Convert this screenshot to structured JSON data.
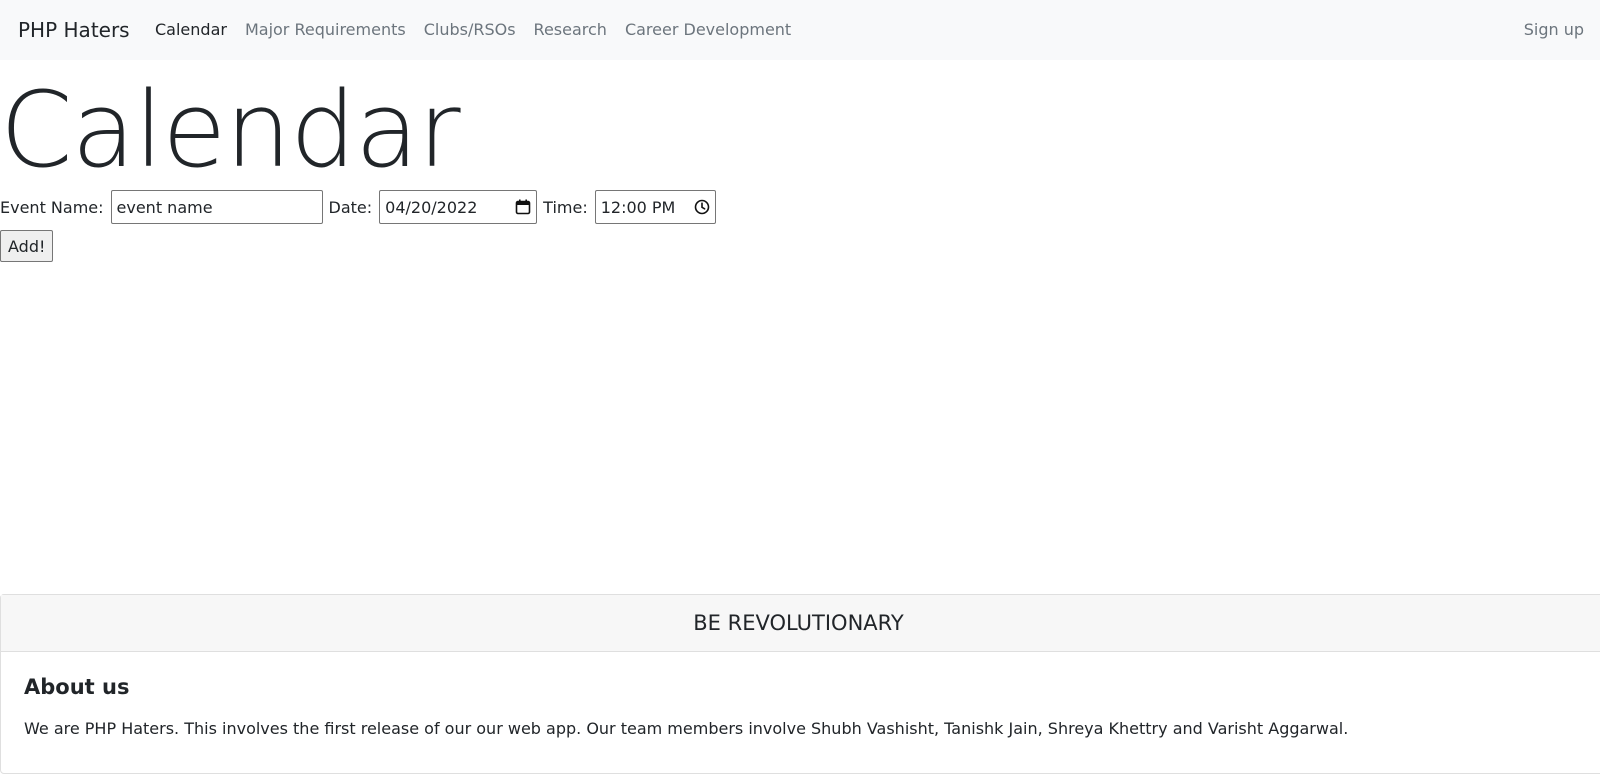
{
  "navbar": {
    "brand": "PHP Haters",
    "links": [
      {
        "label": "Calendar",
        "active": true
      },
      {
        "label": "Major Requirements",
        "active": false
      },
      {
        "label": "Clubs/RSOs",
        "active": false
      },
      {
        "label": "Research",
        "active": false
      },
      {
        "label": "Career Development",
        "active": false
      }
    ],
    "signup": "Sign up"
  },
  "main": {
    "title": "Calendar",
    "form": {
      "event_name_label": "Event Name:",
      "event_name_value": "event name",
      "date_label": "Date:",
      "date_value": "04/20/2022",
      "date_icon": "calendar-icon",
      "time_label": "Time:",
      "time_value": "12:00 PM",
      "time_icon": "clock-icon",
      "submit_label": "Add!"
    }
  },
  "footer_card": {
    "header": "BE REVOLUTIONARY",
    "title": "About us",
    "text": "We are PHP Haters. This involves the first release of our our web app. Our team members involve Shubh Vashisht, Tanishk Jain, Shreya Khettry and Varisht Aggarwal."
  }
}
